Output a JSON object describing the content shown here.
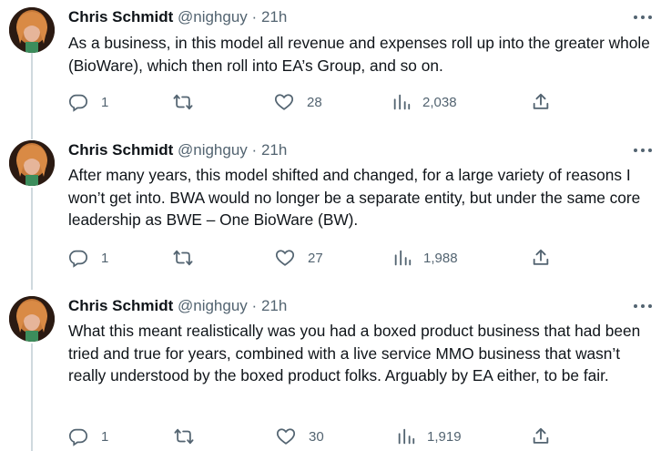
{
  "tweets": [
    {
      "author_name": "Chris Schmidt",
      "handle": "@nighguy",
      "separator": "·",
      "time": "21h",
      "text": "As a business, in this model all revenue and expenses roll up into the greater whole (BioWare), which then roll into EA’s Group, and so on.",
      "replies": "1",
      "retweets": "",
      "likes": "28",
      "views": "2,038"
    },
    {
      "author_name": "Chris Schmidt",
      "handle": "@nighguy",
      "separator": "·",
      "time": "21h",
      "text": "After many years, this model shifted and changed, for a large variety of reasons I won’t get into. BWA would no longer be a separate entity, but under the same core leadership as BWE – One BioWare (BW).",
      "replies": "1",
      "retweets": "",
      "likes": "27",
      "views": "1,988"
    },
    {
      "author_name": "Chris Schmidt",
      "handle": "@nighguy",
      "separator": "·",
      "time": "21h",
      "text": "What this meant realistically was you had a boxed product business that had been tried and true for years, combined with a live service MMO business that wasn’t really understood by the boxed product folks. Arguably by EA either, to be fair.",
      "replies": "1",
      "retweets": "",
      "likes": "30",
      "views": "1,919"
    }
  ],
  "icons": {
    "reply": "reply-icon",
    "retweet": "retweet-icon",
    "like": "heart-icon",
    "views": "views-icon",
    "share": "share-icon",
    "more": "more-icon"
  },
  "colors": {
    "text": "#0f1419",
    "secondary": "#536471",
    "thread_line": "#cfd9de"
  }
}
